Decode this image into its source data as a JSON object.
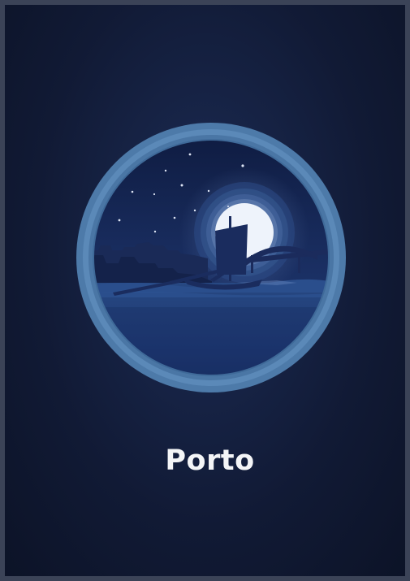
{
  "poster": {
    "title": "Porto",
    "background_color": "#111a35",
    "frame_color": "#3b4357",
    "ring_color": "#4d7aa9",
    "moon_color": "#eef3fb",
    "icons": [
      "porthole-ring",
      "moon-icon",
      "star-icon",
      "rabelo-boat-icon",
      "bridge-icon",
      "city-skyline-icon"
    ]
  }
}
